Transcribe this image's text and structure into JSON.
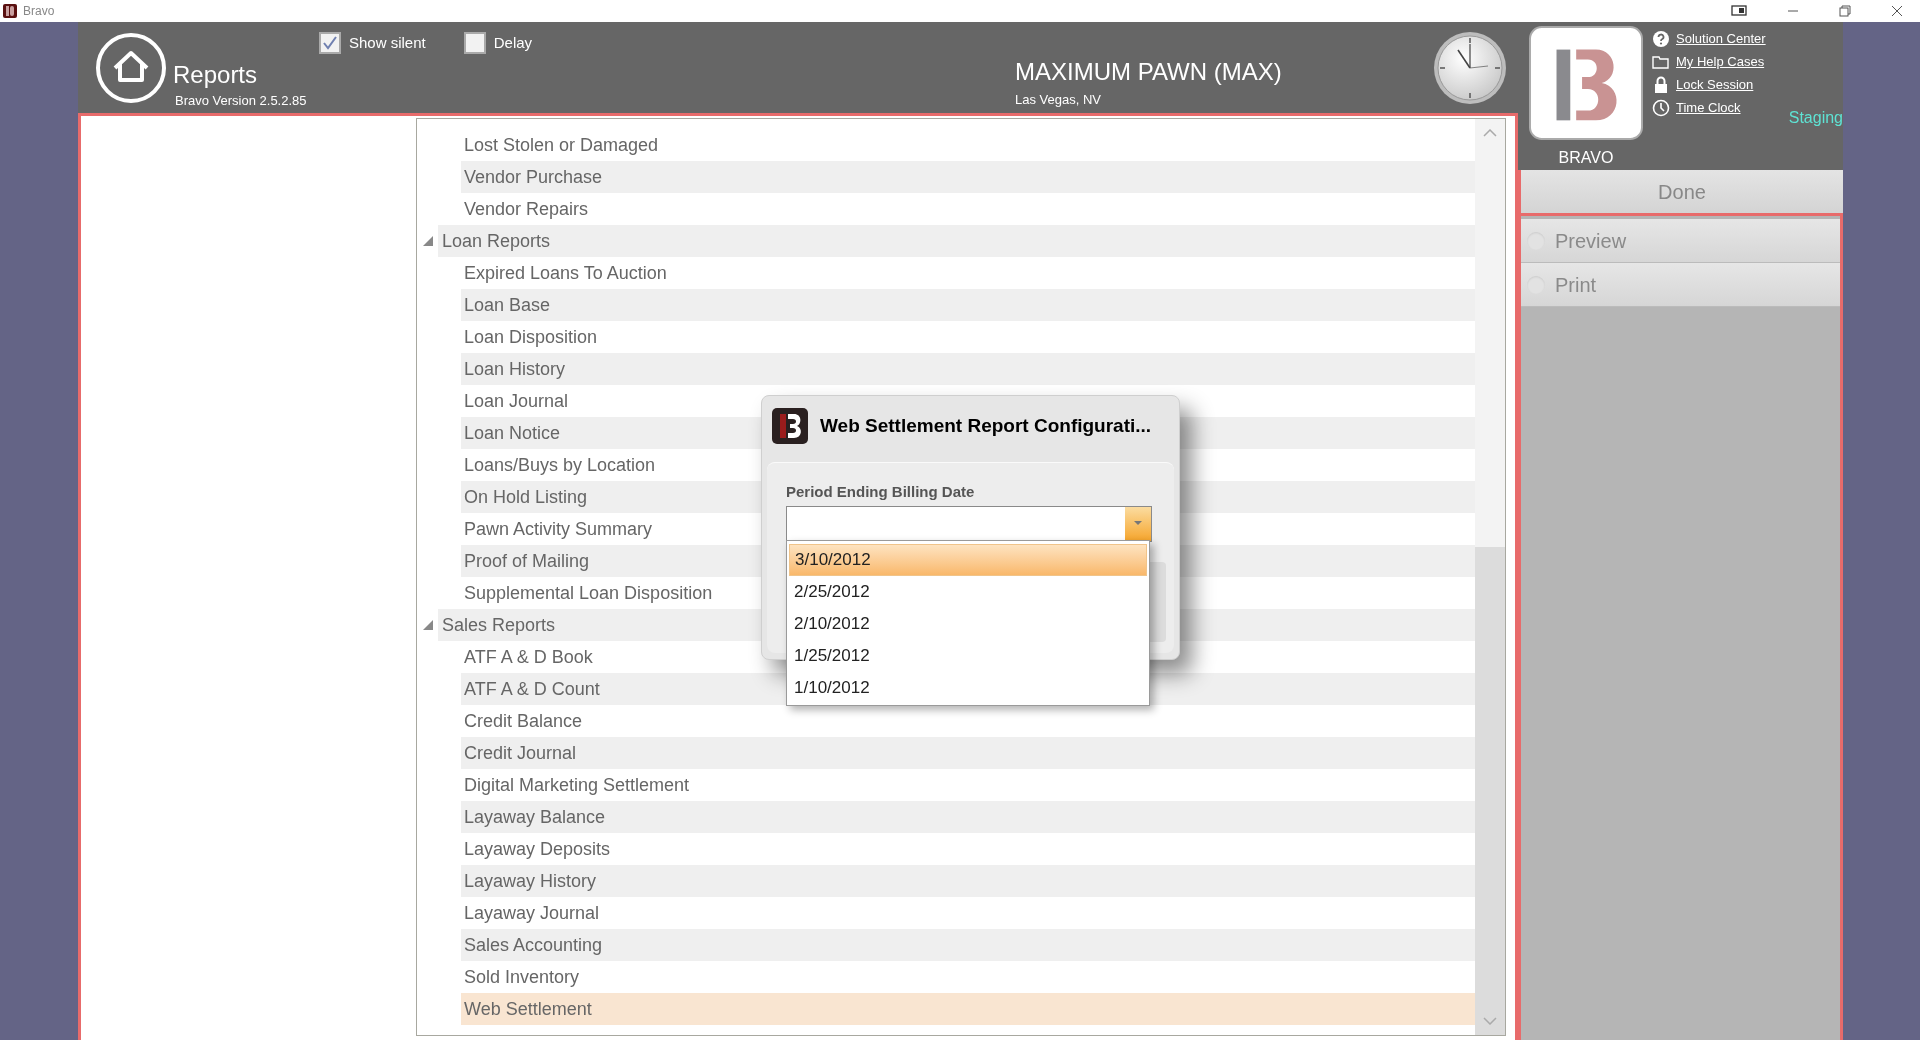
{
  "window": {
    "title": "Bravo"
  },
  "header": {
    "title": "Reports",
    "version": "Bravo Version 2.5.2.85",
    "options": [
      {
        "label": "Show silent",
        "checked": true
      },
      {
        "label": "Delay",
        "checked": false
      }
    ],
    "store_name": "MAXIMUM PAWN (MAX)",
    "store_location": "Las Vegas, NV"
  },
  "brand": {
    "name": "BRAVO",
    "environment": "Staging"
  },
  "help_links": [
    {
      "kind": "help",
      "label": "Solution Center"
    },
    {
      "kind": "folder",
      "label": "My Help Cases"
    },
    {
      "kind": "lock",
      "label": "Lock Session"
    },
    {
      "kind": "clock",
      "label": "Time Clock"
    }
  ],
  "actions": {
    "done": "Done",
    "outputs": [
      {
        "label": "Preview",
        "selected": false
      },
      {
        "label": "Print",
        "selected": false
      }
    ]
  },
  "report_tree": {
    "leading_items": [
      {
        "label": "Lost Stolen or Damaged",
        "selected": false
      },
      {
        "label": "Vendor Purchase",
        "selected": false
      },
      {
        "label": "Vendor Repairs",
        "selected": false
      }
    ],
    "groups": [
      {
        "label": "Loan Reports",
        "expanded": true,
        "children": [
          {
            "label": "Expired Loans To Auction",
            "selected": false
          },
          {
            "label": "Loan Base",
            "selected": false
          },
          {
            "label": "Loan Disposition",
            "selected": false
          },
          {
            "label": "Loan History",
            "selected": false
          },
          {
            "label": "Loan Journal",
            "selected": false
          },
          {
            "label": "Loan Notice",
            "selected": false
          },
          {
            "label": "Loans/Buys by Location",
            "selected": false
          },
          {
            "label": "On Hold Listing",
            "selected": false
          },
          {
            "label": "Pawn Activity Summary",
            "selected": false
          },
          {
            "label": "Proof of Mailing",
            "selected": false
          },
          {
            "label": "Supplemental Loan Disposition",
            "selected": false
          }
        ]
      },
      {
        "label": "Sales Reports",
        "expanded": true,
        "children": [
          {
            "label": "ATF A & D Book",
            "selected": false
          },
          {
            "label": "ATF A & D Count",
            "selected": false
          },
          {
            "label": "Credit Balance",
            "selected": false
          },
          {
            "label": "Credit Journal",
            "selected": false
          },
          {
            "label": "Digital Marketing Settlement",
            "selected": false
          },
          {
            "label": "Layaway Balance",
            "selected": false
          },
          {
            "label": "Layaway Deposits",
            "selected": false
          },
          {
            "label": "Layaway History",
            "selected": false
          },
          {
            "label": "Layaway Journal",
            "selected": false
          },
          {
            "label": "Sales Accounting",
            "selected": false
          },
          {
            "label": "Sold Inventory",
            "selected": false
          },
          {
            "label": "Web Settlement",
            "selected": true
          }
        ]
      }
    ]
  },
  "dialog": {
    "title": "Web Settlement Report Configurati...",
    "field_label": "Period Ending Billing Date",
    "options": [
      {
        "label": "3/10/2012",
        "selected": true
      },
      {
        "label": "2/25/2012",
        "selected": false
      },
      {
        "label": "2/10/2012",
        "selected": false
      },
      {
        "label": "1/25/2012",
        "selected": false
      },
      {
        "label": "1/10/2012",
        "selected": false
      }
    ]
  }
}
